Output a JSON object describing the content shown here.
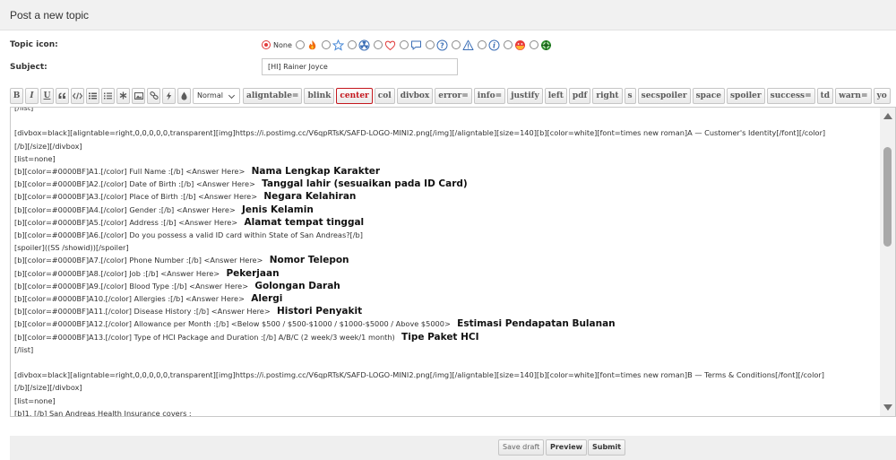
{
  "header": {
    "title": "Post a new topic"
  },
  "topic_icon": {
    "label": "Topic icon:",
    "options": [
      {
        "name": "none",
        "label": "None",
        "selected": true
      },
      {
        "name": "fire-icon"
      },
      {
        "name": "star-icon"
      },
      {
        "name": "radioactive-icon"
      },
      {
        "name": "heart-icon"
      },
      {
        "name": "speech-bubble-icon"
      },
      {
        "name": "question-icon"
      },
      {
        "name": "warning-icon"
      },
      {
        "name": "info-icon"
      },
      {
        "name": "red-face-icon"
      },
      {
        "name": "green-face-icon"
      }
    ]
  },
  "subject": {
    "label": "Subject:",
    "value": "[HI] Rainer Joyce"
  },
  "toolbar": {
    "icon_buttons": [
      "B",
      "I",
      "U",
      "quote-icon",
      "code-icon",
      "list-icon",
      "numbered-list-icon",
      "asterisk-icon",
      "image-icon",
      "link-icon",
      "flash-icon",
      "font-color-icon"
    ],
    "font_size": "Normal",
    "tags": [
      "aligntable=",
      "blink",
      "center",
      "col",
      "divbox",
      "error=",
      "info=",
      "justify",
      "left",
      "pdf",
      "right",
      "s",
      "secspoiler",
      "space",
      "spoiler",
      "success=",
      "td",
      "warn=",
      "yo"
    ]
  },
  "editor": {
    "lines": [
      {
        "text": "[/list]"
      },
      {
        "text": ""
      },
      {
        "text": "[divbox=black][aligntable=right,0,0,0,0,0,transparent][img]https://i.postimg.cc/V6qpRTsK/SAFD-LOGO-MINI2.png[/img][/aligntable][size=140][b][color=white][font=times new roman]A — Customer's Identity[/font][/color]"
      },
      {
        "text": "[/b][/size][/divbox]"
      },
      {
        "text": "[list=none]"
      },
      {
        "text": "[b][color=#0000BF]A1.[/color] Full Name :[/b] <Answer Here>",
        "bold": "Nama Lengkap Karakter"
      },
      {
        "text": "[b][color=#0000BF]A2.[/color] Date of Birth :[/b] <Answer Here>",
        "bold": "Tanggal lahir (sesuaikan pada ID Card)"
      },
      {
        "text": "[b][color=#0000BF]A3.[/color] Place of Birth :[/b] <Answer Here>",
        "bold": "Negara Kelahiran"
      },
      {
        "text": "[b][color=#0000BF]A4.[/color] Gender :[/b] <Answer Here>",
        "bold": "Jenis Kelamin"
      },
      {
        "text": "[b][color=#0000BF]A5.[/color] Address :[/b] <Answer Here>",
        "bold": "Alamat tempat tinggal"
      },
      {
        "text": "[b][color=#0000BF]A6.[/color] Do you possess a valid ID card within State of San Andreas?[/b]"
      },
      {
        "text": "[spoiler]((SS /showid))[/spoiler]"
      },
      {
        "text": "[b][color=#0000BF]A7.[/color] Phone Number :[/b] <Answer Here>",
        "bold": "Nomor Telepon"
      },
      {
        "text": "[b][color=#0000BF]A8.[/color] Job :[/b] <Answer Here>",
        "bold": "Pekerjaan"
      },
      {
        "text": "[b][color=#0000BF]A9.[/color] Blood Type :[/b] <Answer Here>",
        "bold": "Golongan Darah"
      },
      {
        "text": "[b][color=#0000BF]A10.[/color] Allergies :[/b] <Answer Here>",
        "bold": "Alergi"
      },
      {
        "text": "[b][color=#0000BF]A11.[/color] Disease History :[/b] <Answer Here>",
        "bold": "Histori Penyakit"
      },
      {
        "text": "[b][color=#0000BF]A12.[/color] Allowance per Month :[/b] <Below $500 / $500-$1000 / $1000-$5000 / Above $5000>",
        "bold": "Estimasi Pendapatan Bulanan"
      },
      {
        "text": "[b][color=#0000BF]A13.[/color] Type of HCI Package and Duration :[/b] A/B/C (2 week/3 week/1 month)",
        "bold": "Tipe Paket HCI"
      },
      {
        "text": "[/list]"
      },
      {
        "text": ""
      },
      {
        "text": "[divbox=black][aligntable=right,0,0,0,0,0,transparent][img]https://i.postimg.cc/V6qpRTsK/SAFD-LOGO-MINI2.png[/img][/aligntable][size=140][b][color=white][font=times new roman]B — Terms & Conditions[/font][/color]"
      },
      {
        "text": "[/b][/size][/divbox]"
      },
      {
        "text": "[list=none]"
      },
      {
        "text": "[b]1. [/b] San Andreas Health Insurance covers :"
      }
    ]
  },
  "buttons": {
    "save_draft": "Save draft",
    "preview": "Preview",
    "submit": "Submit"
  }
}
